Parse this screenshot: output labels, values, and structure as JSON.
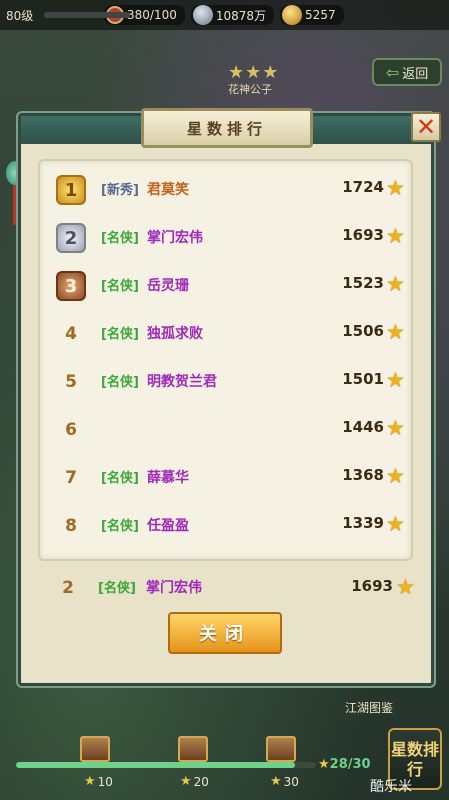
{
  "topbar": {
    "level": "80级",
    "stamina": "380/100",
    "silver": "10878万",
    "gold": "5257"
  },
  "hero": {
    "stars": "★★★",
    "name": "花神公子"
  },
  "back_button": {
    "label": "返回"
  },
  "panel": {
    "title": "星数排行",
    "close_icon": "✕",
    "close_button": "关闭"
  },
  "rankings": [
    {
      "rank": "1",
      "tag": "[新秀]",
      "name": "君莫笑",
      "name_color": "#c0641a",
      "score": "1724"
    },
    {
      "rank": "2",
      "tag": "[名侠]",
      "name": "掌门宏伟",
      "name_color": "#a02ab8",
      "score": "1693"
    },
    {
      "rank": "3",
      "tag": "[名侠]",
      "name": "岳灵珊",
      "name_color": "#a02ab8",
      "score": "1523"
    },
    {
      "rank": "4",
      "tag": "[名侠]",
      "name": "独孤求败",
      "name_color": "#a02ab8",
      "score": "1506"
    },
    {
      "rank": "5",
      "tag": "[名侠]",
      "name": "明教贺兰君",
      "name_color": "#a02ab8",
      "score": "1501"
    },
    {
      "rank": "6",
      "tag": "",
      "name": "",
      "name_color": "#a02ab8",
      "score": "1446"
    },
    {
      "rank": "7",
      "tag": "[名侠]",
      "name": "薛慕华",
      "name_color": "#a02ab8",
      "score": "1368"
    },
    {
      "rank": "8",
      "tag": "[名侠]",
      "name": "任盈盈",
      "name_color": "#a02ab8",
      "score": "1339"
    }
  ],
  "self_entry": {
    "rank": "2",
    "tag": "[名侠]",
    "name": "掌门宏伟",
    "score": "1693"
  },
  "bottom": {
    "guide_label": "江湖图鉴",
    "chest_thresholds": [
      "10",
      "20",
      "30"
    ],
    "star_progress": "28/30",
    "star_progress_value": 0.93,
    "rank_badge": "星数排行",
    "watermark": "酷乐米"
  },
  "colors": {
    "star": "#f2b21a",
    "tag_new": "#5a6890",
    "tag_ms": "#3ca63a"
  }
}
